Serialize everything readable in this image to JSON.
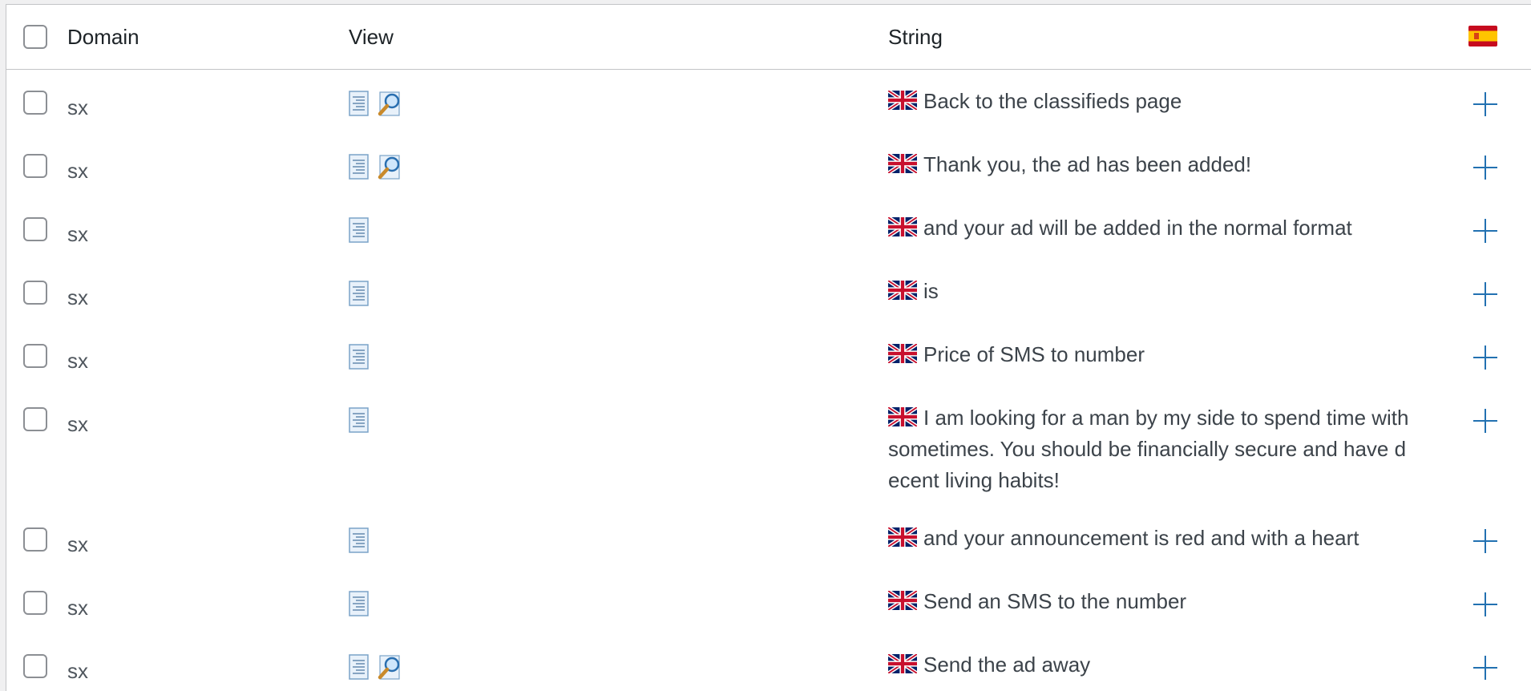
{
  "header": {
    "domain_label": "Domain",
    "view_label": "View",
    "string_label": "String",
    "language_flag": "flag-es-icon"
  },
  "colors": {
    "accent": "#2271b1",
    "border": "#c3c4c7",
    "text": "#3c434a"
  },
  "rows": [
    {
      "domain": "sx",
      "icons": [
        "document-icon",
        "magnifier-icon"
      ],
      "string": "Back to the classifieds page"
    },
    {
      "domain": "sx",
      "icons": [
        "document-icon",
        "magnifier-icon"
      ],
      "string": "Thank you, the ad has been added!"
    },
    {
      "domain": "sx",
      "icons": [
        "document-icon"
      ],
      "string": "and your ad will be added in the normal format"
    },
    {
      "domain": "sx",
      "icons": [
        "document-icon"
      ],
      "string": "is"
    },
    {
      "domain": "sx",
      "icons": [
        "document-icon"
      ],
      "string": "Price of SMS to number"
    },
    {
      "domain": "sx",
      "icons": [
        "document-icon"
      ],
      "string": "I am looking for a man by my side to spend time with sometimes. You should be financially secure and have decent living habits!"
    },
    {
      "domain": "sx",
      "icons": [
        "document-icon"
      ],
      "string": "and your announcement is red and with a heart"
    },
    {
      "domain": "sx",
      "icons": [
        "document-icon"
      ],
      "string": "Send an SMS to the number"
    },
    {
      "domain": "sx",
      "icons": [
        "document-icon",
        "magnifier-icon"
      ],
      "string": "Send the ad away"
    }
  ]
}
